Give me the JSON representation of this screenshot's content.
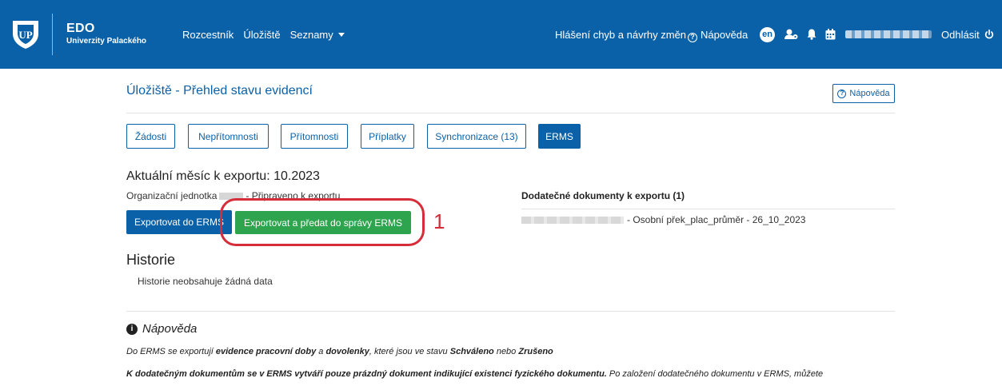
{
  "header": {
    "brand_title": "EDO",
    "brand_subtitle": "Univerzity Palackého",
    "nav": [
      {
        "label": "Rozcestník"
      },
      {
        "label": "Úložiště"
      },
      {
        "label": "Seznamy"
      }
    ],
    "report_link": "Hlášení chyb a návrhy změn",
    "help_link": "Nápověda",
    "lang": "en",
    "logout": "Odhlásit",
    "bg_color": "#0a61a8"
  },
  "page": {
    "title": "Úložiště - Přehled stavu evidencí",
    "help_button": "Nápověda",
    "tabs": [
      {
        "label": "Žádosti"
      },
      {
        "label": "Nepřítomnosti"
      },
      {
        "label": "Přítomnosti"
      },
      {
        "label": "Příplatky"
      },
      {
        "label": "Synchronizace (13)"
      },
      {
        "label": "ERMS",
        "active": true
      }
    ]
  },
  "export": {
    "title": "Aktuální měsíc k exportu: 10.2023",
    "org_prefix": "Organizační jednotka",
    "org_suffix": "- Připraveno k exportu",
    "export_button": "Exportovat do ERMS",
    "export_hand_button": "Exportovat a předat do správy ERMS",
    "callout_number": "1",
    "extra_title": "Dodatečné dokumenty k exportu (1)",
    "extra_row_suffix": "- Osobní přek_plac_průměr - 26_10_2023"
  },
  "history": {
    "title": "Historie",
    "empty": "Historie neobsahuje žádná data"
  },
  "help": {
    "title": "Nápověda",
    "p1_a": "Do ERMS se exportují ",
    "p1_b": "evidence pracovní doby",
    "p1_c": " a ",
    "p1_d": "dovolenky",
    "p1_e": ", které jsou ve stavu ",
    "p1_f": "Schváleno",
    "p1_g": " nebo ",
    "p1_h": "Zrušeno",
    "p2_a": "K dodatečným dokumentům se v ERMS vytváří pouze prázdný dokument indikující existenci fyzického dokumentu.",
    "p2_b": " Po založení dodatečného dokumentu v ERMS, můžete"
  }
}
